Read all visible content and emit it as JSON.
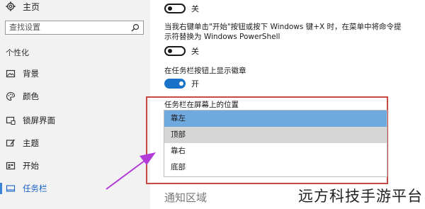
{
  "sidebar": {
    "home_label": "主页",
    "search_placeholder": "查找设置",
    "section_label": "个性化",
    "items": [
      {
        "label": "背景",
        "icon": "image-icon"
      },
      {
        "label": "颜色",
        "icon": "palette-icon"
      },
      {
        "label": "锁屏界面",
        "icon": "lock-screen-icon"
      },
      {
        "label": "主题",
        "icon": "theme-icon"
      },
      {
        "label": "开始",
        "icon": "start-icon"
      },
      {
        "label": "任务栏",
        "icon": "taskbar-icon",
        "active": true
      }
    ]
  },
  "main": {
    "toggle1": {
      "state_label": "关",
      "on": false
    },
    "powershell_desc": "当我右键单击\"开始\"按钮或按下 Windows 键+X 时，在菜单中将命令提示符替换为 Windows PowerShell",
    "toggle2": {
      "state_label": "关",
      "on": false
    },
    "badge_label": "在任务栏按钮上显示徽章",
    "toggle3": {
      "state_label": "开",
      "on": true
    },
    "location_label": "任务栏在屏幕上的位置",
    "location_options": [
      "靠左",
      "顶部",
      "靠右",
      "底部"
    ],
    "selected_option": "靠左",
    "next_section": "通知区域"
  },
  "watermark": "远方科技手游平台",
  "colors": {
    "accent": "#1a72c8",
    "selected_option": "#6fa9dd",
    "highlight_border": "#c94a45",
    "arrow": "#b23ad6"
  }
}
